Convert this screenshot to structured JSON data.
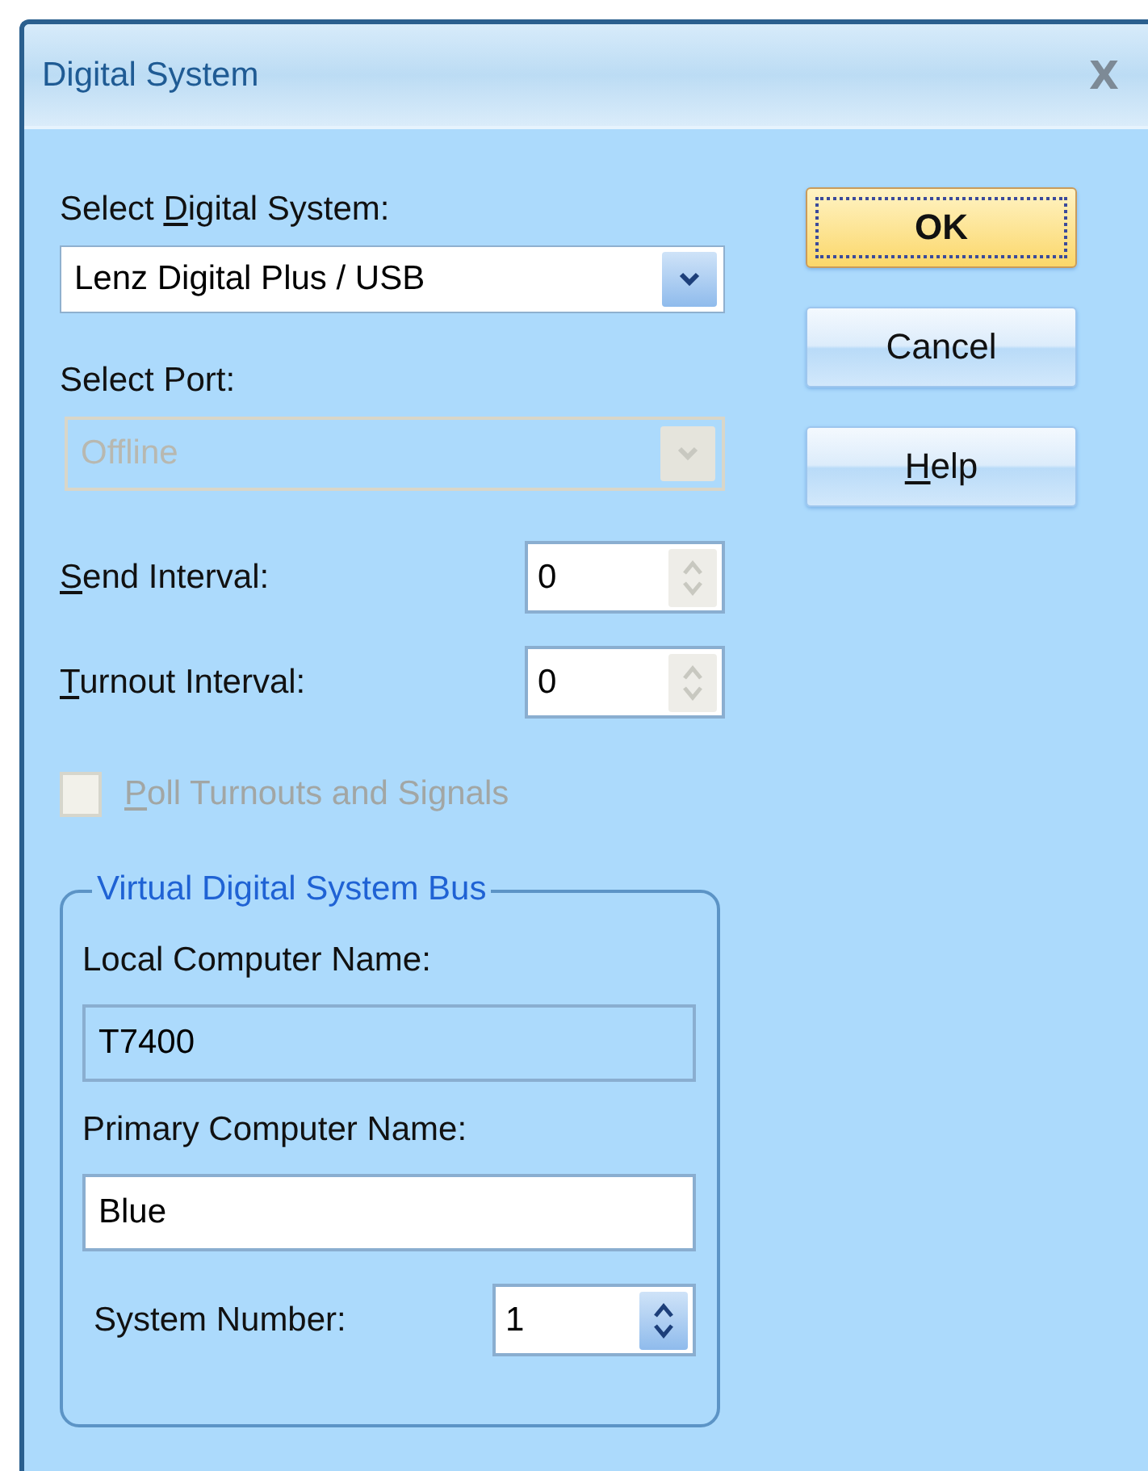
{
  "window": {
    "title": "Digital System",
    "close": "X"
  },
  "system_select": {
    "label": {
      "pre": "Select ",
      "key": "D",
      "post": "igital System:"
    },
    "value": "Lenz Digital Plus / USB",
    "disabled": false
  },
  "port_select": {
    "label": {
      "post": "Select Port:"
    },
    "value": "Offline",
    "disabled": true
  },
  "intervals": [
    {
      "label": {
        "key": "S",
        "post": "end Interval:"
      },
      "value": "0",
      "disabled": true
    },
    {
      "label": {
        "key": "T",
        "post": "urnout Interval:"
      },
      "value": "0",
      "disabled": true
    }
  ],
  "poll_checkbox": {
    "label": {
      "key": "P",
      "post": "oll Turnouts and Signals"
    },
    "checked": false,
    "disabled": true
  },
  "bus_group": {
    "title": "Virtual Digital System Bus",
    "local_name": {
      "label": "Local Computer Name:",
      "value": "T7400",
      "readonly": true
    },
    "primary_name": {
      "label": "Primary Computer Name:",
      "value": "Blue",
      "readonly": false
    },
    "system_number": {
      "label": "System Number:",
      "value": "1",
      "disabled": false
    }
  },
  "buttons": [
    {
      "label": {
        "post": "OK"
      },
      "default": true
    },
    {
      "label": {
        "post": "Cancel"
      },
      "default": false
    },
    {
      "label": {
        "key": "H",
        "post": "elp"
      },
      "default": false
    }
  ]
}
